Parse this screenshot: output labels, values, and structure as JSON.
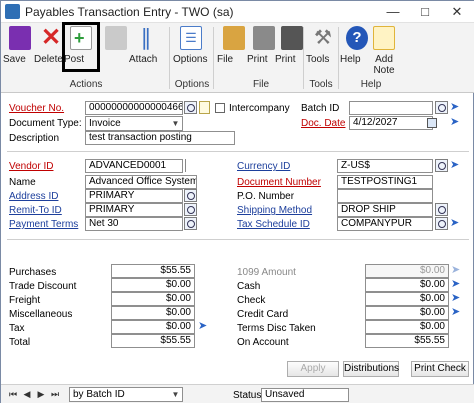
{
  "window": {
    "title": "Payables Transaction Entry  -  TWO (sa)",
    "controls": [
      "—",
      "□",
      "✕"
    ]
  },
  "ribbon": {
    "buttons": [
      {
        "label": "Save",
        "icon": "save-icon",
        "color": "#7a2fb0"
      },
      {
        "label": "Delete",
        "icon": "delete-icon",
        "color": "#d62828"
      },
      {
        "label": "Post",
        "icon": "post-icon",
        "color": "#2e9d3c"
      },
      {
        "label": "",
        "icon": "grid-icon",
        "color": "#9a9a9a"
      },
      {
        "label": "Attach",
        "icon": "attach-icon",
        "color": "#3a6fc2"
      },
      {
        "label": "Options",
        "icon": "options-icon",
        "color": "#4b7cc9"
      },
      {
        "label": "File",
        "icon": "folder-icon",
        "color": "#d9a441"
      },
      {
        "label": "Print",
        "icon": "print-icon",
        "color": "#555555"
      },
      {
        "label": "Print",
        "icon": "print-icon",
        "color": "#555555"
      },
      {
        "label": "Tools",
        "icon": "tools-icon",
        "color": "#777777"
      },
      {
        "label": "Help",
        "icon": "help-icon",
        "color": "#2457b8"
      },
      {
        "label": "Add Note",
        "icon": "add-note-icon",
        "color": "#e0b43a"
      }
    ],
    "groups": {
      "actions": "Actions",
      "options": "Options",
      "file": "File",
      "tools": "Tools",
      "help": "Help"
    }
  },
  "form": {
    "voucher_no": {
      "label": "Voucher No.",
      "value": "00000000000000466"
    },
    "document_type": {
      "label": "Document Type:",
      "value": "Invoice"
    },
    "description": {
      "label": "Description",
      "value": "test transaction posting"
    },
    "intercompany": {
      "label": "Intercompany"
    },
    "batch_id": {
      "label": "Batch ID",
      "value": ""
    },
    "doc_date": {
      "label": "Doc. Date",
      "value": "4/12/2027"
    },
    "vendor_id": {
      "label": "Vendor ID",
      "value": "ADVANCED0001"
    },
    "name": {
      "label": "Name",
      "value": "Advanced Office Systems"
    },
    "address_id": {
      "label": "Address ID",
      "value": "PRIMARY"
    },
    "remit_to_id": {
      "label": "Remit-To ID",
      "value": "PRIMARY"
    },
    "payment_terms": {
      "label": "Payment Terms",
      "value": "Net 30"
    },
    "currency_id": {
      "label": "Currency ID",
      "value": "Z-US$"
    },
    "document_number": {
      "label": "Document Number",
      "value": "TESTPOSTING1"
    },
    "po_number": {
      "label": "P.O. Number",
      "value": ""
    },
    "shipping_method": {
      "label": "Shipping Method",
      "value": "DROP SHIP"
    },
    "tax_schedule_id": {
      "label": "Tax Schedule ID",
      "value": "COMPANYPUR"
    }
  },
  "amounts_left": [
    {
      "label": "Purchases",
      "value": "$55.55"
    },
    {
      "label": "Trade Discount",
      "value": "$0.00"
    },
    {
      "label": "Freight",
      "value": "$0.00"
    },
    {
      "label": "Miscellaneous",
      "value": "$0.00"
    },
    {
      "label": "Tax",
      "value": "$0.00"
    },
    {
      "label": "Total",
      "value": "$55.55"
    }
  ],
  "amounts_right": [
    {
      "label": "1099 Amount",
      "value": "$0.00"
    },
    {
      "label": "Cash",
      "value": "$0.00"
    },
    {
      "label": "Check",
      "value": "$0.00"
    },
    {
      "label": "Credit Card",
      "value": "$0.00"
    },
    {
      "label": "Terms Disc Taken",
      "value": "$0.00"
    },
    {
      "label": "On Account",
      "value": "$55.55"
    }
  ],
  "buttons": {
    "apply": "Apply",
    "distributions": "Distributions",
    "print_check": "Print Check"
  },
  "statusbar": {
    "sort_by": "by Batch ID",
    "status_label": "Status",
    "status_value": "Unsaved"
  }
}
